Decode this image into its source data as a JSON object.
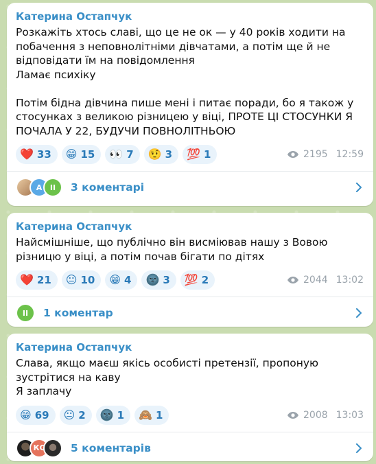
{
  "posts": [
    {
      "author": "Катерина Остапчук",
      "text": "Розкажіть хтось славі, що це не ок — у 40 років ходити на побачення з неповнолітніми дівчатами, а потім ще й не відповідати їм на повідомлення\nЛамає психіку\n\nПотім бідна дівчина пише мені і питає поради, бо я також у стосунках з великою різницею у віці, ПРОТЕ ЦІ СТОСУНКИ Я ПОЧАЛА У 22, БУДУЧИ ПОВНОЛІТНЬОЮ",
      "reactions": [
        {
          "emoji": "❤️",
          "count": "33"
        },
        {
          "emoji": "😁",
          "count": "15"
        },
        {
          "emoji": "👀",
          "count": "7"
        },
        {
          "emoji": "🤨",
          "count": "3"
        },
        {
          "emoji": "💯",
          "count": "1"
        }
      ],
      "views": "2195",
      "time": "12:59",
      "comments": "3 коментарі"
    },
    {
      "author": "Катерина Остапчук",
      "text": "Найсмішніше, що публічно він висміював нашу з Вовою різницю у віці, а потім почав бігати по дітях",
      "reactions": [
        {
          "emoji": "❤️",
          "count": "21"
        },
        {
          "emoji": "😐",
          "count": "10"
        },
        {
          "emoji": "😁",
          "count": "4"
        },
        {
          "emoji": "🌚",
          "count": "3"
        },
        {
          "emoji": "💯",
          "count": "2"
        }
      ],
      "views": "2044",
      "time": "13:02",
      "comments": "1 коментар"
    },
    {
      "author": "Катерина Остапчук",
      "text": "Слава, якщо маєш якісь особисті претензії, пропоную зустрітися на каву\nЯ заплачу",
      "reactions": [
        {
          "emoji": "😁",
          "count": "69"
        },
        {
          "emoji": "😐",
          "count": "2"
        },
        {
          "emoji": "🌚",
          "count": "1"
        },
        {
          "emoji": "🙈",
          "count": "1"
        }
      ],
      "views": "2008",
      "time": "13:03",
      "comments": "5 коментарів"
    }
  ],
  "avatars": {
    "post1": [
      {
        "label": "",
        "color": "#c9a27a"
      },
      {
        "label": "A",
        "color": "#5aa9e6"
      },
      {
        "label": "II",
        "color": "#6cc24a"
      }
    ],
    "post2": [
      {
        "label": "II",
        "color": "#6cc24a"
      }
    ],
    "post3": [
      {
        "label": "",
        "color": "#2b2b2b"
      },
      {
        "label": "КС",
        "color": "#e5735c"
      },
      {
        "label": "",
        "color": "#3a3a3a"
      }
    ]
  },
  "colors": {
    "accent": "#3a8fc7",
    "reaction_bg": "#e9f3fb",
    "wallpaper": "#c9dcb0"
  },
  "icons": {
    "views": "eye-icon",
    "open_comments": "chevron-right-icon"
  }
}
